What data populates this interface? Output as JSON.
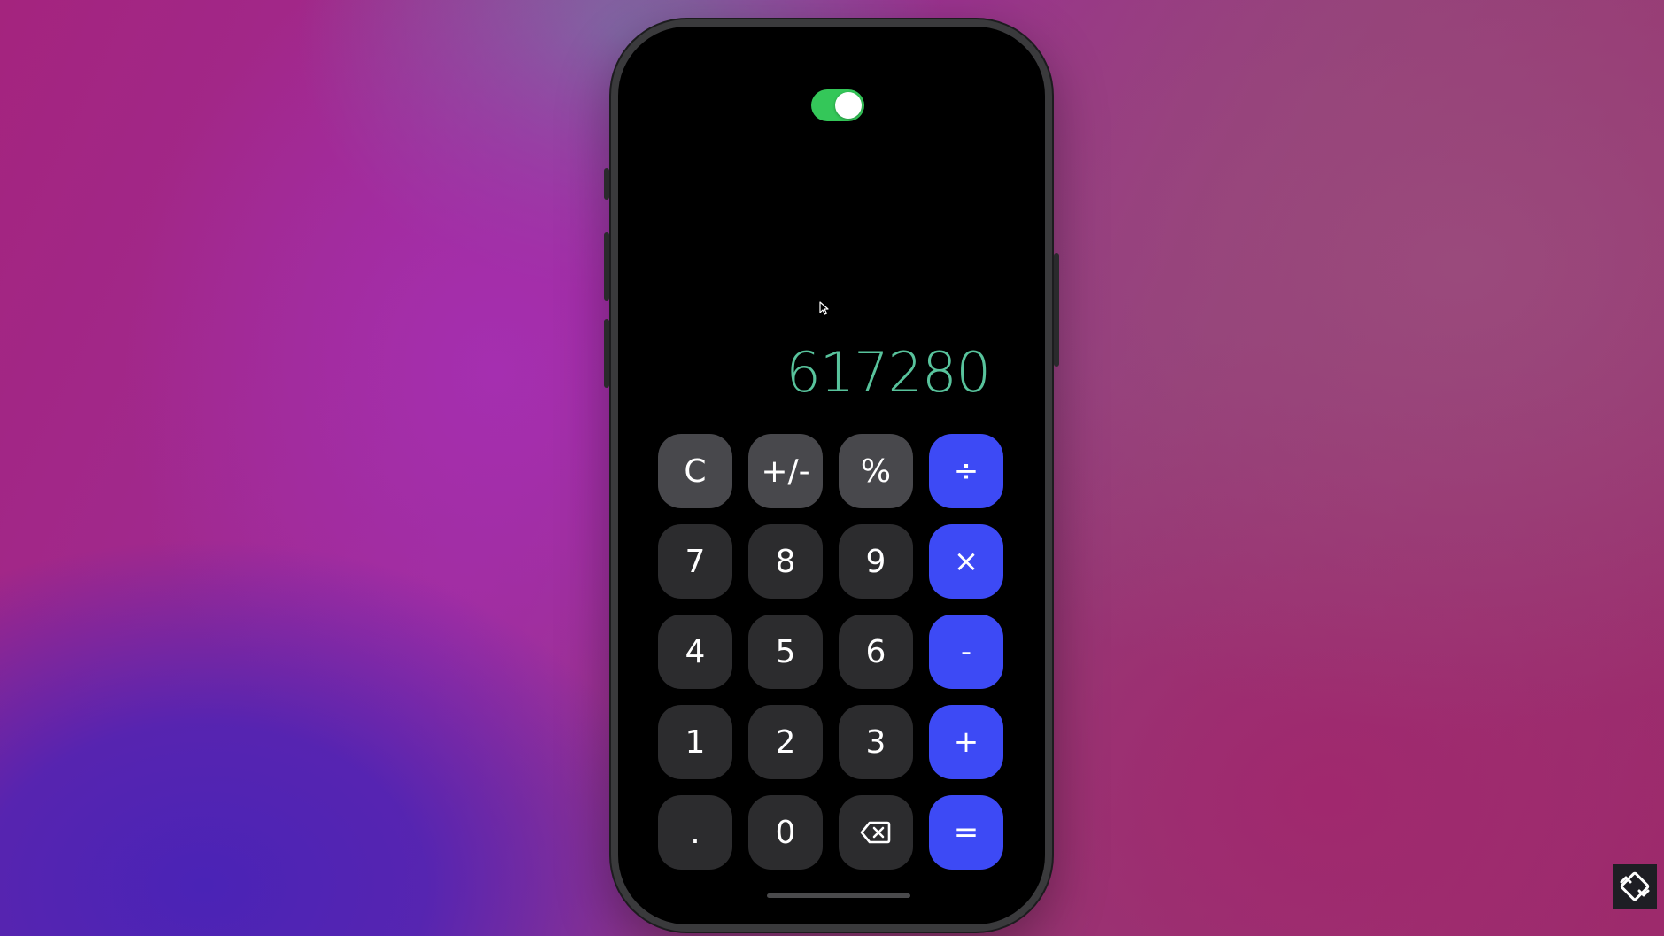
{
  "display": {
    "value": "617280",
    "color": "#58c39c"
  },
  "toggle": {
    "state": "on",
    "color": "#34c759"
  },
  "keypad": {
    "row1": [
      "C",
      "+/-",
      "%",
      "÷"
    ],
    "row2": [
      "7",
      "8",
      "9",
      "×"
    ],
    "row3": [
      "4",
      "5",
      "6",
      "-"
    ],
    "row4": [
      "1",
      "2",
      "3",
      "+"
    ],
    "row5": [
      ".",
      "0",
      "backspace-icon",
      "="
    ]
  },
  "colors": {
    "operator": "#3d4af5",
    "function_key": "#48484c",
    "number_key": "#2c2c2e"
  },
  "icons": {
    "backspace": "backspace-icon",
    "rotate": "rotate-device-icon",
    "cursor": "mouse-pointer-icon"
  }
}
